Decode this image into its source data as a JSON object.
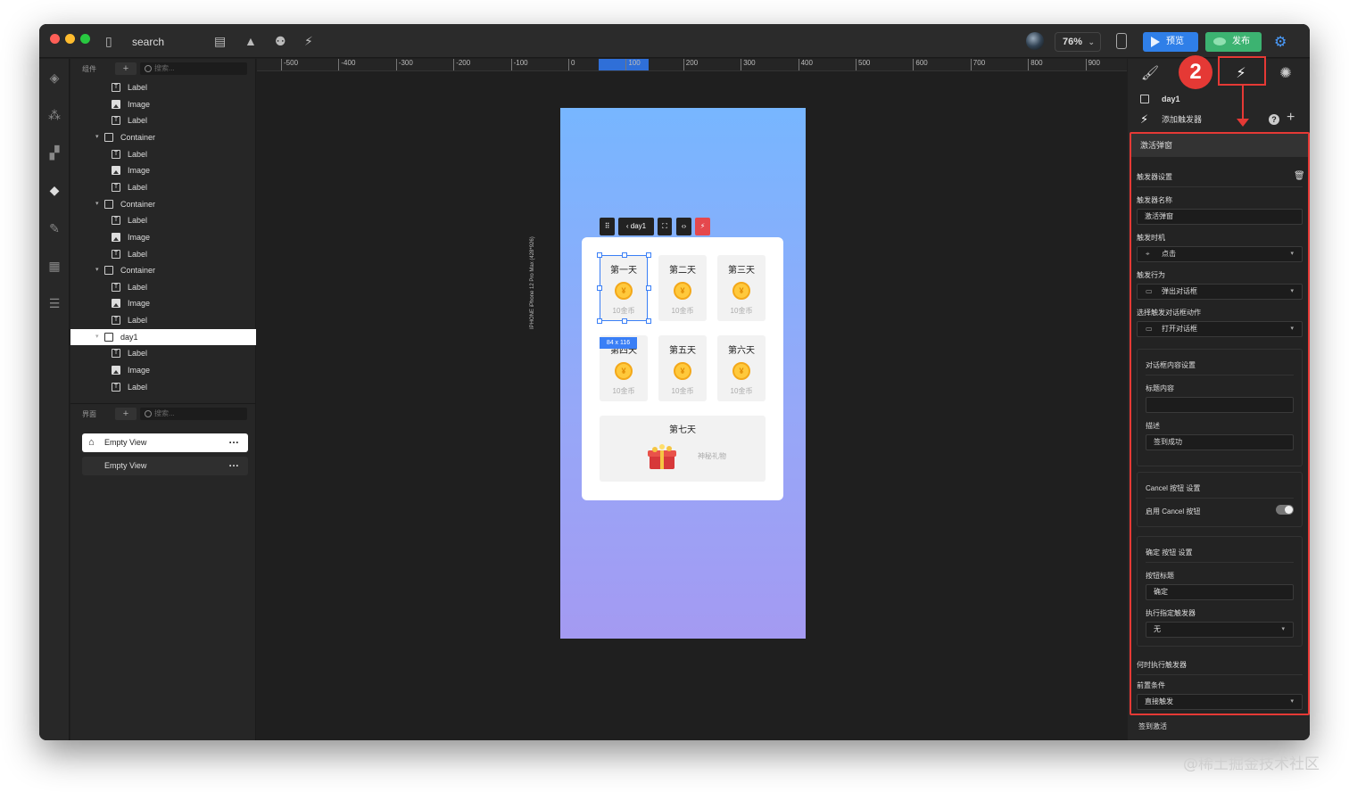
{
  "app": {
    "title": "search",
    "zoom": "76%",
    "preview": "预览",
    "publish": "发布"
  },
  "left": {
    "components_title": "组件",
    "search_placeholder": "搜索...",
    "tree": [
      {
        "label": "Label",
        "type": "label",
        "level": 2
      },
      {
        "label": "Image",
        "type": "image",
        "level": 2
      },
      {
        "label": "Label",
        "type": "label",
        "level": 2
      },
      {
        "label": "Container",
        "type": "container",
        "level": 1
      },
      {
        "label": "Label",
        "type": "label",
        "level": 2
      },
      {
        "label": "Image",
        "type": "image",
        "level": 2
      },
      {
        "label": "Label",
        "type": "label",
        "level": 2
      },
      {
        "label": "Container",
        "type": "container",
        "level": 1
      },
      {
        "label": "Label",
        "type": "label",
        "level": 2
      },
      {
        "label": "Image",
        "type": "image",
        "level": 2
      },
      {
        "label": "Label",
        "type": "label",
        "level": 2
      },
      {
        "label": "Container",
        "type": "container",
        "level": 1
      },
      {
        "label": "Label",
        "type": "label",
        "level": 2
      },
      {
        "label": "Image",
        "type": "image",
        "level": 2
      },
      {
        "label": "Label",
        "type": "label",
        "level": 2
      },
      {
        "label": "day1",
        "type": "container",
        "level": 1,
        "selected": true
      },
      {
        "label": "Label",
        "type": "label",
        "level": 2
      },
      {
        "label": "Image",
        "type": "image",
        "level": 2
      },
      {
        "label": "Label",
        "type": "label",
        "level": 2
      }
    ],
    "views_title": "界面",
    "views": [
      {
        "label": "Empty View",
        "home": true,
        "active": true
      },
      {
        "label": "Empty View",
        "home": false,
        "active": false
      }
    ]
  },
  "ruler": [
    "-500",
    "-400",
    "-300",
    "-200",
    "-100",
    "0",
    "100",
    "200",
    "300",
    "400",
    "500",
    "600",
    "700",
    "800",
    "900"
  ],
  "canvas": {
    "device_label": "IPHONE   iPhone 12 Pro Max (428*926)",
    "toolbar_day": "day1",
    "size_badge": "84 x 116",
    "days": [
      {
        "name": "第一天",
        "amount": "10金币"
      },
      {
        "name": "第二天",
        "amount": "10金币"
      },
      {
        "name": "第三天",
        "amount": "10金币"
      },
      {
        "name": "第四天",
        "amount": "10金币"
      },
      {
        "name": "第五天",
        "amount": "10金币"
      },
      {
        "name": "第六天",
        "amount": "10金币"
      }
    ],
    "coin_symbol": "¥",
    "day7": {
      "name": "第七天",
      "gift_text": "神秘礼物"
    }
  },
  "right": {
    "day_name": "day1",
    "add_trigger": "添加触发器",
    "trigger_title": "激活弹窗",
    "trigger_settings": "触发器设置",
    "name_label": "触发器名称",
    "name_value": "激活弹窗",
    "timing_label": "触发时机",
    "timing_value": "点击",
    "action_label": "触发行为",
    "action_value": "弹出对话框",
    "dialog_action_label": "选择触发对话框动作",
    "dialog_action_value": "打开对话框",
    "content_settings": "对话框内容设置",
    "title_content_label": "标题内容",
    "title_content_value": "",
    "desc_label": "描述",
    "desc_value": "签到成功",
    "cancel_settings": "Cancel 按钮 设置",
    "enable_cancel": "启用 Cancel 按钮",
    "confirm_settings": "确定 按钮 设置",
    "btn_title_label": "按钮标题",
    "btn_title_value": "确定",
    "exec_label": "执行指定触发器",
    "exec_value": "无",
    "when_label": "何时执行触发器",
    "precondition_label": "前置条件",
    "precondition_value": "直接触发",
    "bottom_text": "签到激活"
  },
  "annotation": {
    "badge": "2"
  },
  "watermark": "@稀土掘金技术社区"
}
